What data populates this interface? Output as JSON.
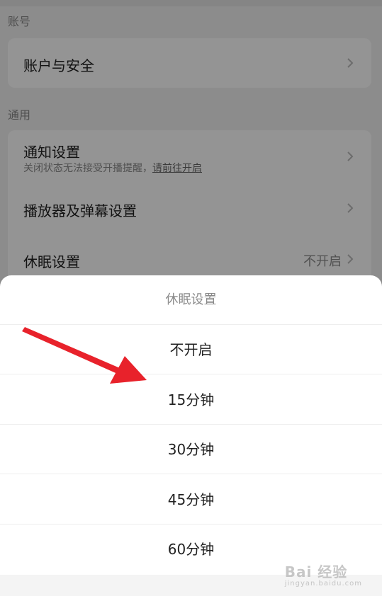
{
  "settings": {
    "sections": {
      "account_header": "账号",
      "general_header": "通用"
    },
    "rows": {
      "account_security": "账户与安全",
      "notification_title": "通知设置",
      "notification_sub": "关闭状态无法接受开播提醒，",
      "notification_link": "请前往开启",
      "player": "播放器及弹幕设置",
      "sleep_title": "休眠设置",
      "sleep_value": "不开启"
    }
  },
  "sheet": {
    "title": "休眠设置",
    "options": [
      "不开启",
      "15分钟",
      "30分钟",
      "45分钟",
      "60分钟"
    ]
  },
  "annotation": {
    "arrow_color": "#e8222b"
  },
  "watermark": {
    "text": "Bai 经验",
    "url": "jingyan.baidu.com"
  }
}
